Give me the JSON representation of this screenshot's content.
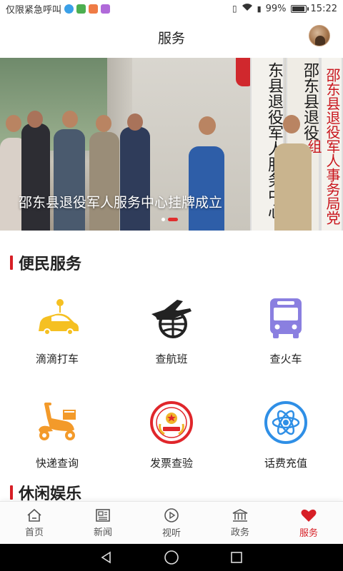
{
  "status_bar": {
    "carrier": "仅限紧急呼叫",
    "battery": "99%",
    "time": "15:22"
  },
  "header": {
    "title": "服务"
  },
  "banner": {
    "caption": "邵东县退役军人服务中心挂牌成立",
    "plaque_1": "东县退役军人服务中心",
    "plaque_2": "邵东县退役",
    "plaque_3": "邵东县退役军人事务局党组",
    "slide_count": 2,
    "active_slide": 2
  },
  "sections": {
    "convenience": {
      "title": "便民服务",
      "items": [
        {
          "label": "滴滴打车",
          "icon": "taxi-icon"
        },
        {
          "label": "查航班",
          "icon": "airplane-globe-icon"
        },
        {
          "label": "查火车",
          "icon": "bus-icon"
        },
        {
          "label": "快递查询",
          "icon": "courier-scooter-icon"
        },
        {
          "label": "发票查验",
          "icon": "emblem-icon"
        },
        {
          "label": "话费充值",
          "icon": "atom-icon"
        }
      ]
    },
    "leisure": {
      "title": "休闲娱乐"
    }
  },
  "bottom_nav": {
    "tabs": [
      {
        "label": "首页",
        "icon": "home-icon"
      },
      {
        "label": "新闻",
        "icon": "news-icon"
      },
      {
        "label": "视听",
        "icon": "play-icon"
      },
      {
        "label": "政务",
        "icon": "government-icon"
      },
      {
        "label": "服务",
        "icon": "heart-icon"
      }
    ],
    "active_index": 4
  },
  "colors": {
    "accent": "#d71f26",
    "taxi_yellow": "#f5c022",
    "bus_purple": "#8a7fe0",
    "courier_orange": "#f39a2a",
    "atom_blue": "#2f8fe6"
  }
}
